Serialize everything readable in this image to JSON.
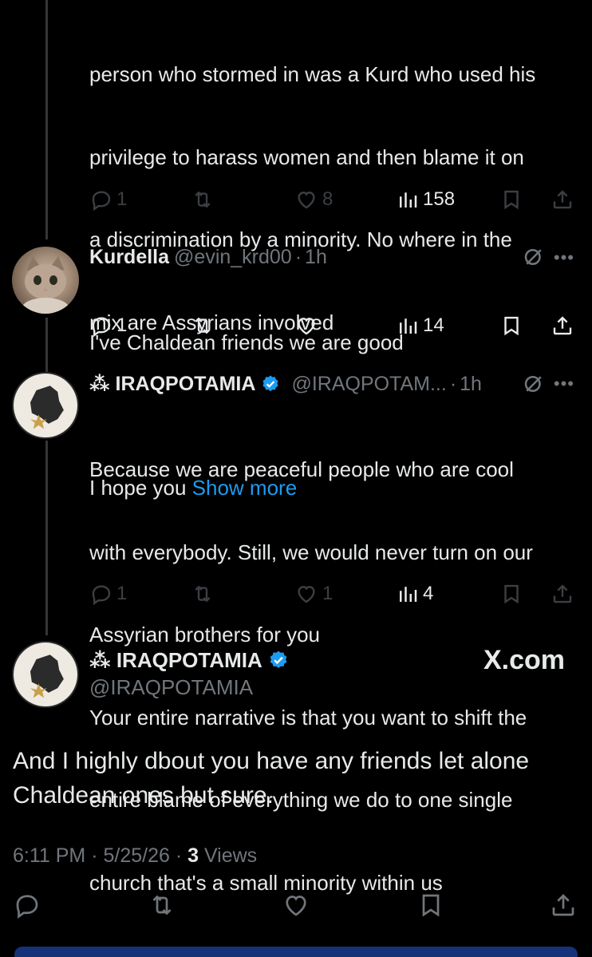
{
  "tweets": [
    {
      "text_lines": [
        "person who stormed in was a Kurd who used his",
        "privilege to harass women and then blame it on",
        "a discrimination by a minority. No where in the",
        "mix are Assyrians involved",
        "",
        "I hope you"
      ],
      "show_more": "Show more",
      "replies": "1",
      "reposts": "",
      "likes": "8",
      "views": "158"
    },
    {
      "name": "Kurdella",
      "handle": "@evin_krd00",
      "dot": "·",
      "time": "1h",
      "text_lines": [
        "I've Chaldean friends we are good"
      ],
      "replies": "1",
      "reposts": "",
      "likes": "",
      "views": "14"
    },
    {
      "name": "⁂ IRAQPOTAMIA",
      "handle": "@IRAQPOTAM...",
      "dot": "·",
      "time": "1h",
      "text_lines": [
        "Because we are peaceful people who are cool",
        "with everybody. Still, we would never turn on our",
        "Assyrian brothers for you",
        "Your entire narrative is that you want to shift the",
        "entire blame of everything we do to one single",
        "church that's a small minority within us"
      ],
      "replies": "1",
      "reposts": "",
      "likes": "1",
      "views": "4"
    }
  ],
  "main_tweet": {
    "name": "⁂ IRAQPOTAMIA",
    "handle": "@IRAQPOTAMIA",
    "watermark": "X.com",
    "text_lines": [
      "And I highly dbout you have any friends let alone",
      "Chaldean ones but sure."
    ],
    "meta_time": "6:11 PM · 5/25/26 · ",
    "meta_views_count": "3",
    "meta_views_label": " Views"
  },
  "icons": {
    "reply": "reply-icon",
    "repost": "repost-icon",
    "like": "heart-icon",
    "views": "views-icon",
    "bookmark": "bookmark-icon",
    "share": "share-icon",
    "verified": "verified-badge-icon",
    "grok": "grok-icon",
    "more": "more-icon"
  },
  "colors": {
    "background": "#000000",
    "text": "#e7e9ea",
    "muted": "#71767b",
    "link": "#1d9bf0",
    "verified": "#1d9bf0"
  }
}
